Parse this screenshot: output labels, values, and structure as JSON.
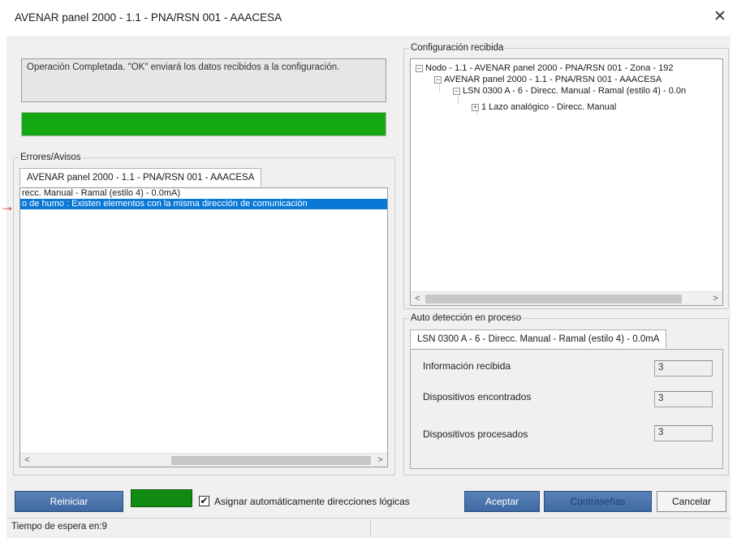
{
  "window": {
    "title": "AVENAR panel 2000 - 1.1 - PNA/RSN 001 - AAACESA",
    "close_glyph": "✕"
  },
  "status": {
    "message": "Operación Completada. \"OK\" enviará los datos recibidos a la configuración.",
    "progress_percent": 100,
    "progress_color": "#13a813"
  },
  "errors_group": {
    "legend": "Errores/Avisos",
    "tab_label": "AVENAR panel 2000 - 1.1 - PNA/RSN 001 - AAACESA",
    "rows": [
      "recc. Manual - Ramal (estilo 4) - 0.0mA)",
      "o de humo : Existen elementos con la misma dirección de comunicación"
    ],
    "selected_row_index": 1,
    "marker_arrow": "→",
    "marker_color": "#e0201b"
  },
  "config_group": {
    "legend": "Configuración recibida",
    "tree": [
      {
        "label": "Nodo - 1.1 - AVENAR panel 2000 - PNA/RSN 001 - Zona - 192",
        "toggle": "−"
      },
      {
        "label": "AVENAR panel 2000 - 1.1 - PNA/RSN 001 - AAACESA",
        "toggle": "−"
      },
      {
        "label": "LSN 0300 A - 6 - Direcc. Manual - Ramal (estilo 4) - 0.0n",
        "toggle": "−"
      },
      {
        "label": "1 Lazo analógico - Direcc. Manual",
        "toggle": "+"
      }
    ]
  },
  "autodetect_group": {
    "legend": "Auto detección en proceso",
    "tab_label": "LSN 0300 A - 6 - Direcc. Manual - Ramal (estilo 4) - 0.0mA",
    "fields": [
      {
        "label": "Información recibida",
        "value": "3"
      },
      {
        "label": "Dispositivos encontrados",
        "value": "3"
      },
      {
        "label": "Dispositivos procesados",
        "value": "3"
      }
    ]
  },
  "scroll_arrows": {
    "left": "<",
    "right": ">"
  },
  "buttons": {
    "reiniciar": "Reiniciar",
    "aceptar": "Aceptar",
    "contrasenas": "Contraseñas",
    "cancelar": "Cancelar"
  },
  "checkbox": {
    "label": "Asignar automáticamente direcciones lógicas",
    "checked": true,
    "check_glyph": "✔"
  },
  "indicator_color": "#118a11",
  "status_bar": {
    "text": "Tiempo de espera en:9"
  }
}
